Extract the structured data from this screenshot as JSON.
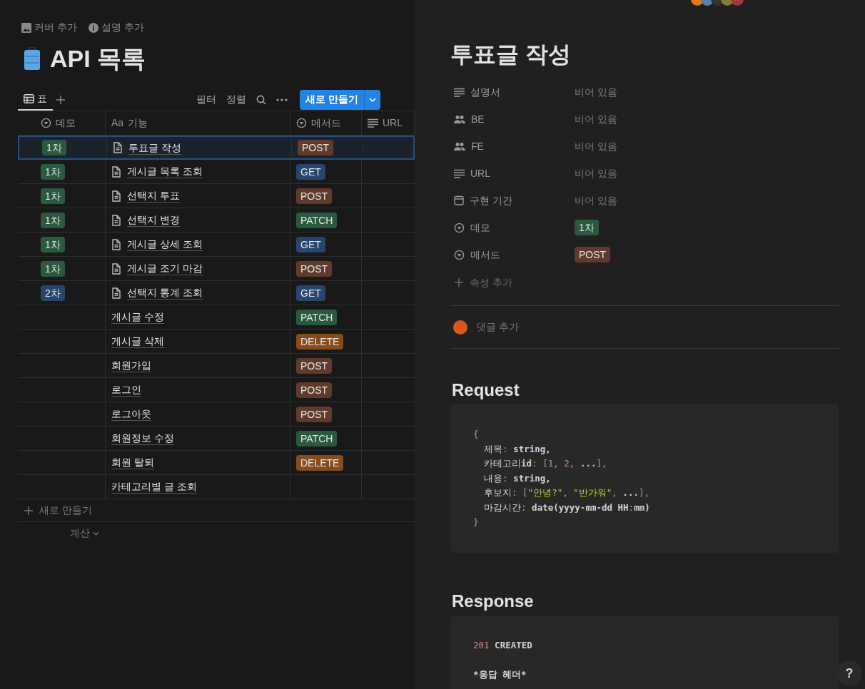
{
  "page_actions": [
    {
      "kind": "cover",
      "label": "커버 추가"
    },
    {
      "kind": "info",
      "label": "설명 추가"
    }
  ],
  "title": "API 목록",
  "views": [
    {
      "label": "표",
      "selected": true
    }
  ],
  "toolbar": [
    "필터",
    "정렬"
  ],
  "new_button": "새로 만들기",
  "table": {
    "columns": [
      {
        "label": "데모",
        "kind": "select"
      },
      {
        "label": "기능",
        "kind": "title",
        "icon_text": "Aa"
      },
      {
        "label": "메서드",
        "kind": "select"
      },
      {
        "label": "URL",
        "kind": "text"
      }
    ],
    "rows": [
      {
        "demo": {
          "label": "1차",
          "color": "#2b593f"
        },
        "name": "투표글 작성",
        "has_page": true,
        "method": {
          "label": "POST",
          "color": "#603b2c"
        },
        "selected": true
      },
      {
        "demo": {
          "label": "1차",
          "color": "#2b593f"
        },
        "name": "게시글 목록 조회",
        "has_page": true,
        "method": {
          "label": "GET",
          "color": "#28456c"
        },
        "selected": false
      },
      {
        "demo": {
          "label": "1차",
          "color": "#2b593f"
        },
        "name": "선택지 투표",
        "has_page": true,
        "method": {
          "label": "POST",
          "color": "#603b2c"
        },
        "selected": false
      },
      {
        "demo": {
          "label": "1차",
          "color": "#2b593f"
        },
        "name": "선택지 변경",
        "has_page": true,
        "method": {
          "label": "PATCH",
          "color": "#2b593f"
        },
        "selected": false
      },
      {
        "demo": {
          "label": "1차",
          "color": "#2b593f"
        },
        "name": "게시글 상세 조회",
        "has_page": true,
        "method": {
          "label": "GET",
          "color": "#28456c"
        },
        "selected": false
      },
      {
        "demo": {
          "label": "1차",
          "color": "#2b593f"
        },
        "name": "게시글 조기 마감",
        "has_page": true,
        "method": {
          "label": "POST",
          "color": "#603b2c"
        },
        "selected": false
      },
      {
        "demo": {
          "label": "2차",
          "color": "#28456c"
        },
        "name": "선택지 통계 조회",
        "has_page": true,
        "method": {
          "label": "GET",
          "color": "#28456c"
        },
        "selected": false
      },
      {
        "name": "게시글 수정",
        "has_page": false,
        "method": {
          "label": "PATCH",
          "color": "#2b593f"
        },
        "selected": false
      },
      {
        "name": "게시글 삭제",
        "has_page": false,
        "method": {
          "label": "DELETE",
          "color": "#854c1d"
        },
        "selected": false
      },
      {
        "name": "회원가입",
        "has_page": false,
        "method": {
          "label": "POST",
          "color": "#603b2c"
        },
        "selected": false
      },
      {
        "name": "로그인",
        "has_page": false,
        "method": {
          "label": "POST",
          "color": "#603b2c"
        },
        "selected": false
      },
      {
        "name": "로그아웃",
        "has_page": false,
        "method": {
          "label": "POST",
          "color": "#603b2c"
        },
        "selected": false
      },
      {
        "name": "회원정보 수정",
        "has_page": false,
        "method": {
          "label": "PATCH",
          "color": "#2b593f"
        },
        "selected": false
      },
      {
        "name": "회원 탈퇴",
        "has_page": false,
        "method": {
          "label": "DELETE",
          "color": "#854c1d"
        },
        "selected": false
      },
      {
        "name": "카테고리별 글 조회",
        "has_page": false,
        "selected": false
      }
    ]
  },
  "add_row": "새로 만들기",
  "calculate": "계산",
  "detail": {
    "title": "투표글 작성",
    "properties": [
      {
        "kind": "text",
        "label": "설명서",
        "value": "비어 있음"
      },
      {
        "kind": "person",
        "label": "BE",
        "value": "비어 있음"
      },
      {
        "kind": "person",
        "label": "FE",
        "value": "비어 있음"
      },
      {
        "kind": "text",
        "label": "URL",
        "value": "비어 있음"
      },
      {
        "kind": "date",
        "label": "구현 기간",
        "value": "비어 있음"
      },
      {
        "kind": "select",
        "label": "데모",
        "tag": {
          "label": "1차",
          "color": "#2b593f"
        }
      },
      {
        "kind": "select",
        "label": "메서드",
        "tag": {
          "label": "POST",
          "color": "#603b2c"
        }
      }
    ],
    "add_property": "속성 추가",
    "comment_placeholder": "댓글 추가",
    "sections": [
      {
        "heading": "Request",
        "code": [
          {
            "segments": [
              {
                "kind": "punct",
                "text": "{"
              }
            ]
          },
          {
            "segments": [
              {
                "kind": "key",
                "text": "  제목"
              },
              {
                "kind": "colon",
                "text": ":"
              },
              {
                "kind": "type",
                "text": " string,"
              }
            ]
          },
          {
            "segments": [
              {
                "kind": "key",
                "text": "  카테고리"
              },
              {
                "kind": "type",
                "text": "id"
              },
              {
                "kind": "colon",
                "text": ":"
              },
              {
                "kind": "punct",
                "text": " ["
              },
              {
                "kind": "number",
                "text": "1"
              },
              {
                "kind": "punct",
                "text": ", "
              },
              {
                "kind": "number",
                "text": "2"
              },
              {
                "kind": "punct",
                "text": ", "
              },
              {
                "kind": "type",
                "text": "..."
              },
              {
                "kind": "punct",
                "text": "],"
              }
            ]
          },
          {
            "segments": [
              {
                "kind": "key",
                "text": "  내용"
              },
              {
                "kind": "colon",
                "text": ":"
              },
              {
                "kind": "type",
                "text": " string,"
              }
            ]
          },
          {
            "segments": [
              {
                "kind": "key",
                "text": "  후보지"
              },
              {
                "kind": "colon",
                "text": ":"
              },
              {
                "kind": "punct",
                "text": " ["
              },
              {
                "kind": "string",
                "text": "\"안녕?\""
              },
              {
                "kind": "punct",
                "text": ", "
              },
              {
                "kind": "string",
                "text": "\"반가워\""
              },
              {
                "kind": "punct",
                "text": ", "
              },
              {
                "kind": "type",
                "text": "..."
              },
              {
                "kind": "punct",
                "text": "],"
              }
            ]
          },
          {
            "segments": [
              {
                "kind": "key",
                "text": "  마감시간"
              },
              {
                "kind": "colon",
                "text": ":"
              },
              {
                "kind": "type",
                "text": " date(yyyy-mm-dd HH"
              },
              {
                "kind": "colon",
                "text": ":"
              },
              {
                "kind": "type",
                "text": "mm)"
              }
            ]
          },
          {
            "segments": [
              {
                "kind": "punct",
                "text": "}"
              }
            ]
          }
        ]
      },
      {
        "heading": "Response",
        "code": [
          {
            "segments": [
              {
                "kind": "number",
                "text": "201"
              },
              {
                "kind": "type",
                "text": " CREATED"
              }
            ]
          },
          {
            "gap_before": true,
            "segments": [
              {
                "kind": "type",
                "text": "*응답 헤더*"
              }
            ]
          }
        ]
      }
    ]
  },
  "help_button": "?"
}
